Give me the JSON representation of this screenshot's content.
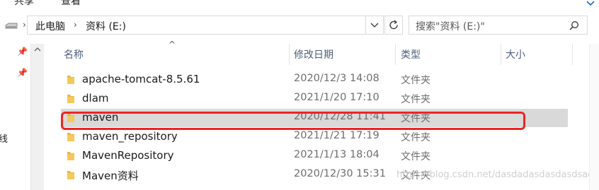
{
  "ribbon": {
    "tabs": [
      "共享",
      "查看"
    ]
  },
  "address": {
    "breadcrumbs": [
      "此电脑",
      "资料 (E:)"
    ]
  },
  "search": {
    "placeholder": "搜索\"资料 (E:)\""
  },
  "columns": {
    "name": "名称",
    "date": "修改日期",
    "type": "类型",
    "size": "大小"
  },
  "nav": {
    "partial_label": "线"
  },
  "files": [
    {
      "name": "apache-tomcat-8.5.61",
      "date": "2020/12/3 14:08",
      "type": "文件夹",
      "selected": false
    },
    {
      "name": "dlam",
      "date": "2021/1/20 17:10",
      "type": "文件夹",
      "selected": false
    },
    {
      "name": "maven",
      "date": "2020/12/28 11:41",
      "type": "文件夹",
      "selected": true
    },
    {
      "name": "maven_repository",
      "date": "2021/1/21 17:19",
      "type": "文件夹",
      "selected": false
    },
    {
      "name": "MavenRepository",
      "date": "2021/1/13 18:04",
      "type": "文件夹",
      "selected": false
    },
    {
      "name": "Maven资料",
      "date": "2020/12/30 15:31",
      "type": "文件夹",
      "selected": false
    }
  ],
  "watermark": "https://blog.csdn.net/dasdadasdasdasdsad",
  "colors": {
    "folder": "#e8b845",
    "highlight": "#ee2424",
    "selected": "#d9d9d9"
  }
}
